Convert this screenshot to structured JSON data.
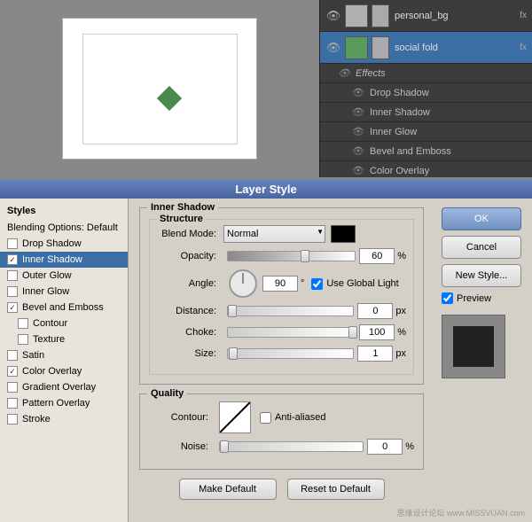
{
  "top": {
    "layers": [
      {
        "id": "personal_bg",
        "name": "personal_bg",
        "thumb_type": "personal",
        "has_eye": true,
        "fx": "fx"
      },
      {
        "id": "social_fold",
        "name": "social fold",
        "thumb_type": "social",
        "has_eye": true,
        "fx": "fx",
        "selected": true
      }
    ],
    "effects": [
      {
        "name": "Drop Shadow",
        "has_eye": true
      },
      {
        "name": "Inner Shadow",
        "has_eye": true
      },
      {
        "name": "Inner Glow",
        "has_eye": true
      },
      {
        "name": "Bevel and Emboss",
        "has_eye": true
      },
      {
        "name": "Color Overlay",
        "has_eye": true
      }
    ]
  },
  "dialog": {
    "title": "Layer Style",
    "styles_heading": "Styles",
    "blending_options": "Blending Options: Default",
    "style_items": [
      {
        "label": "Drop Shadow",
        "checked": false,
        "selected": false
      },
      {
        "label": "Inner Shadow",
        "checked": true,
        "selected": true
      },
      {
        "label": "Outer Glow",
        "checked": false,
        "selected": false
      },
      {
        "label": "Inner Glow",
        "checked": false,
        "selected": false
      },
      {
        "label": "Bevel and Emboss",
        "checked": true,
        "selected": false
      },
      {
        "label": "Contour",
        "checked": false,
        "selected": false,
        "indent": true
      },
      {
        "label": "Texture",
        "checked": false,
        "selected": false,
        "indent": true
      },
      {
        "label": "Satin",
        "checked": false,
        "selected": false
      },
      {
        "label": "Color Overlay",
        "checked": true,
        "selected": false
      },
      {
        "label": "Gradient Overlay",
        "checked": false,
        "selected": false
      },
      {
        "label": "Pattern Overlay",
        "checked": false,
        "selected": false
      },
      {
        "label": "Stroke",
        "checked": false,
        "selected": false
      }
    ],
    "inner_shadow": {
      "section_title": "Inner Shadow",
      "structure_title": "Structure",
      "blend_mode_label": "Blend Mode:",
      "blend_mode_value": "Normal",
      "opacity_label": "Opacity:",
      "opacity_value": "60",
      "opacity_unit": "%",
      "angle_label": "Angle:",
      "angle_value": "90",
      "angle_unit": "°",
      "use_global_light_label": "Use Global Light",
      "distance_label": "Distance:",
      "distance_value": "0",
      "distance_unit": "px",
      "choke_label": "Choke:",
      "choke_value": "100",
      "choke_unit": "%",
      "size_label": "Size:",
      "size_value": "1",
      "size_unit": "px"
    },
    "quality": {
      "section_title": "Quality",
      "contour_label": "Contour:",
      "anti_aliased_label": "Anti-aliased",
      "noise_label": "Noise:",
      "noise_value": "0",
      "noise_unit": "%"
    },
    "make_default_label": "Make Default",
    "reset_to_default_label": "Reset to Default"
  },
  "buttons": {
    "ok": "OK",
    "cancel": "Cancel",
    "new_style": "New Style...",
    "preview_label": "Preview"
  },
  "watermark": "思缘设计论坛  www.MISSVUAN.com"
}
